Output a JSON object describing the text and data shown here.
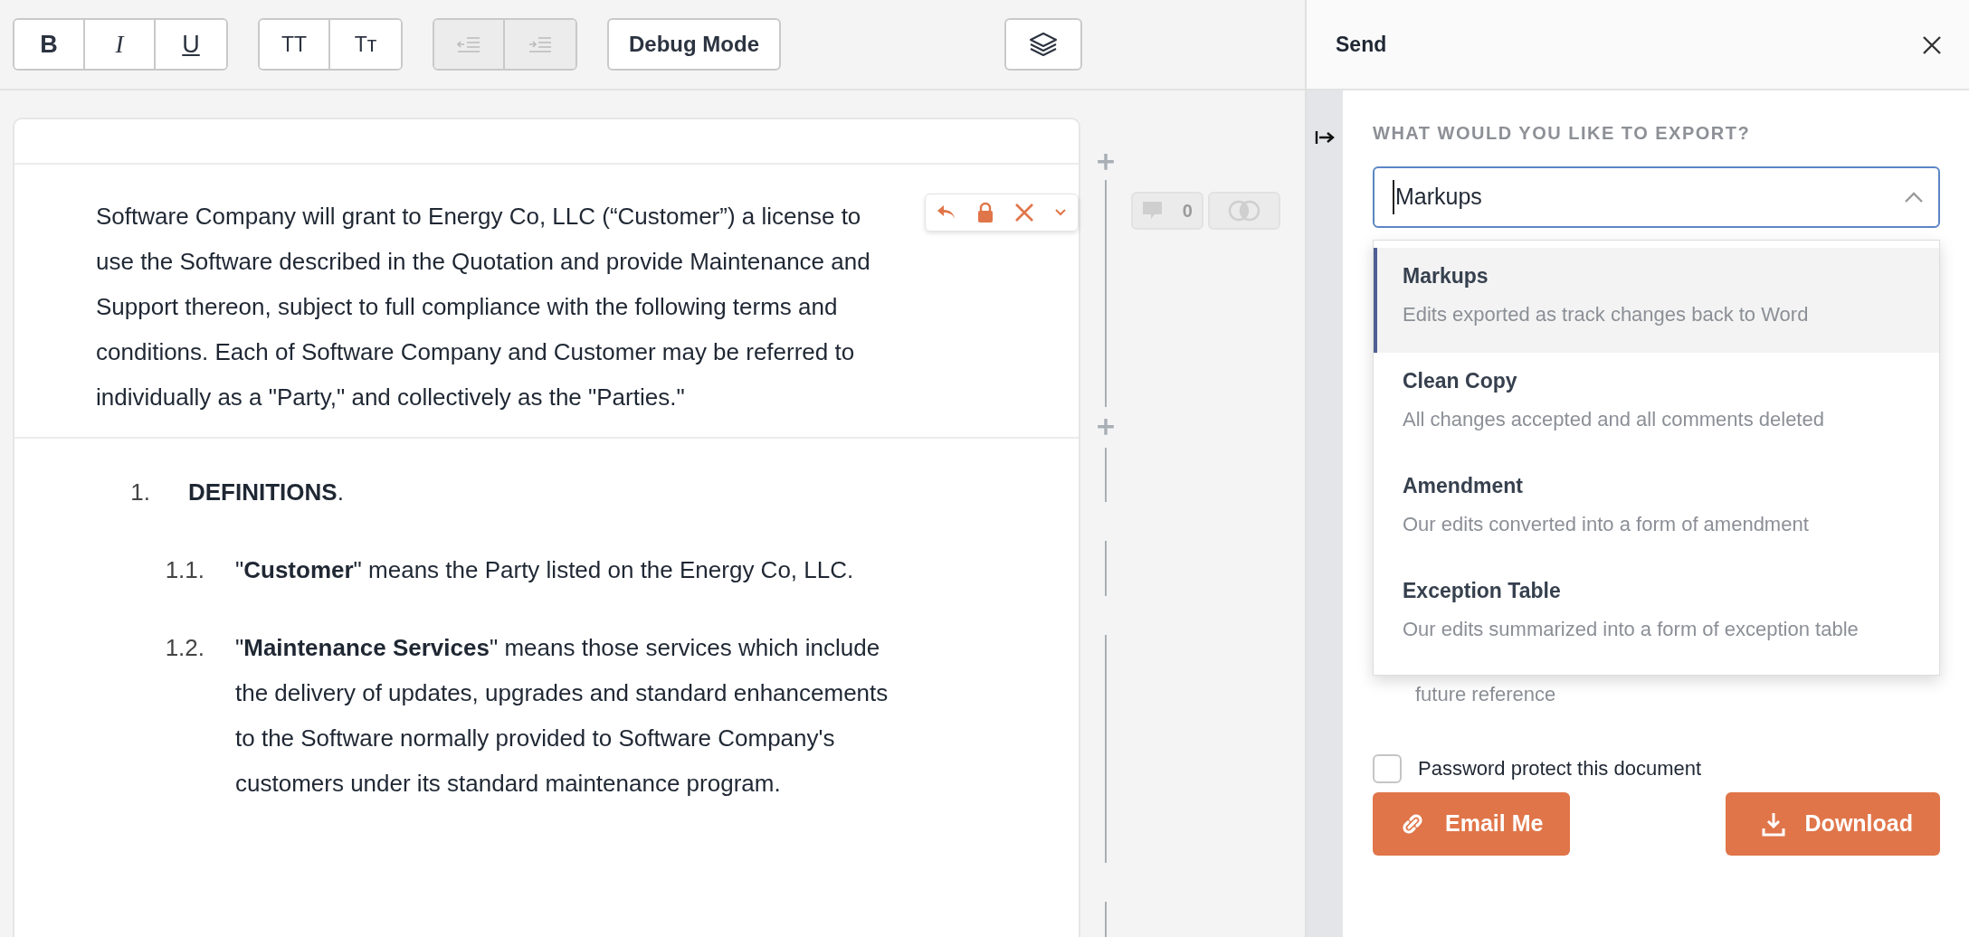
{
  "toolbar": {
    "format_buttons": [
      {
        "label": "B",
        "kind": "bold"
      },
      {
        "label": "I",
        "kind": "italic"
      },
      {
        "label": "U",
        "kind": "underline"
      }
    ],
    "case_buttons": [
      {
        "label": "TT"
      },
      {
        "label": "Tᴛ"
      }
    ],
    "indent_buttons": [
      {
        "kind": "outdent",
        "disabled": true
      },
      {
        "kind": "indent",
        "disabled": true
      }
    ],
    "debug_button": "Debug Mode"
  },
  "document": {
    "intro": "Software Company will grant to Energy Co, LLC (“Customer”) a license to use the Software described in the Quotation and provide Maintenance and Support thereon, subject to full compliance with the following terms and conditions.  Each of Software Company and Customer may be referred to individually as a \"Party,\" and collectively as the \"Parties.\"",
    "clauses": [
      {
        "number": "1.",
        "text": "**DEFINITIONS**.",
        "kind": "section"
      },
      {
        "number": "1.1.",
        "text": "\"**Customer**\" means the Party listed on the Energy Co, LLC.",
        "kind": "sub"
      },
      {
        "number": "1.2.",
        "text": "\"**Maintenance Services**\" means those services which include the delivery of updates, upgrades and standard enhancements to the Software normally provided to Software Company's customers under its standard maintenance program.",
        "kind": "sub"
      }
    ],
    "comment_count": "0"
  },
  "panel": {
    "title": "Send",
    "label": "WHAT WOULD YOU LIKE TO EXPORT?",
    "select_value": "Markups",
    "expanded": true,
    "options": [
      {
        "title": "Markups",
        "description": "Edits exported as track changes back to Word",
        "selected": true
      },
      {
        "title": "Clean Copy",
        "description": "All changes accepted and all comments deleted",
        "selected": false
      },
      {
        "title": "Amendment",
        "description": "Our edits converted into a form of amendment",
        "selected": false
      },
      {
        "title": "Exception Table",
        "description": "Our edits summarized into a form of exception table",
        "selected": false
      }
    ],
    "note": "future reference",
    "password": {
      "label": "Password protect this document",
      "checked": false
    },
    "buttons": [
      {
        "label": "Email Me",
        "kind": "email"
      },
      {
        "label": "Download",
        "kind": "download"
      }
    ]
  }
}
